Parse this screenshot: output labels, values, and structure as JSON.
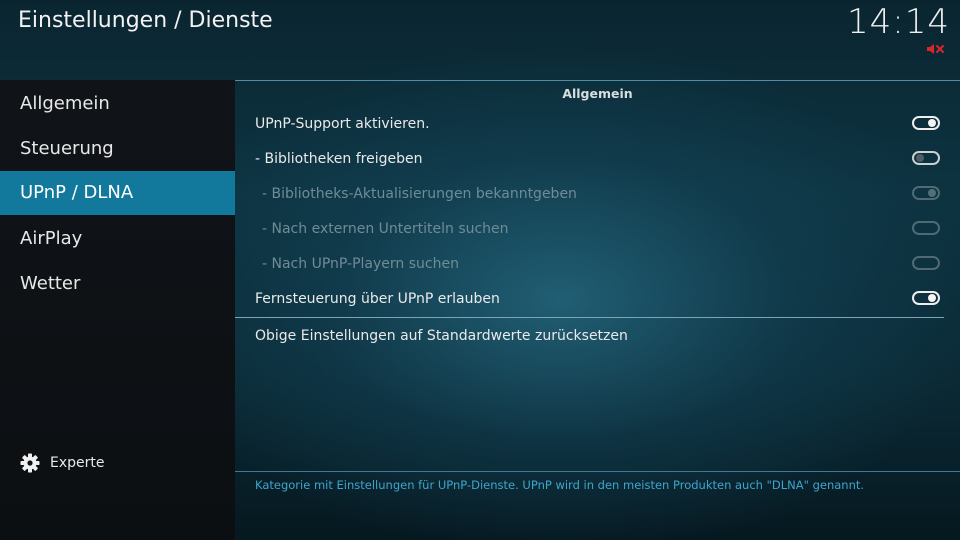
{
  "header": {
    "title": "Einstellungen / Dienste",
    "clock": "14:14",
    "mute_icon": "mute-icon"
  },
  "sidebar": {
    "items": [
      {
        "label": "Allgemein",
        "active": false
      },
      {
        "label": "Steuerung",
        "active": false
      },
      {
        "label": "UPnP / DLNA",
        "active": true
      },
      {
        "label": "AirPlay",
        "active": false
      },
      {
        "label": "Wetter",
        "active": false
      }
    ],
    "settings_level": {
      "label": "Experte",
      "icon": "gear-icon"
    }
  },
  "main": {
    "group_title": "Allgemein",
    "settings": [
      {
        "label": "UPnP-Support aktivieren.",
        "value": true,
        "enabled": true
      },
      {
        "label": "- Bibliotheken freigeben",
        "value": false,
        "enabled": true
      },
      {
        "label": "- Bibliotheks-Aktualisierungen bekanntgeben",
        "value": true,
        "enabled": false
      },
      {
        "label": "- Nach externen Untertiteln suchen",
        "value": false,
        "enabled": false
      },
      {
        "label": "- Nach UPnP-Playern suchen",
        "value": false,
        "enabled": false
      },
      {
        "label": "Fernsteuerung über UPnP erlauben",
        "value": true,
        "enabled": true
      }
    ],
    "reset_label": "Obige Einstellungen auf Standardwerte zurücksetzen",
    "description": "Kategorie mit Einstellungen für UPnP-Dienste. UPnP wird in den meisten Produkten auch \"DLNA\" genannt."
  },
  "colors": {
    "accent": "#12799c",
    "description_text": "#3fa5cc",
    "mute_red": "#d9262b"
  }
}
